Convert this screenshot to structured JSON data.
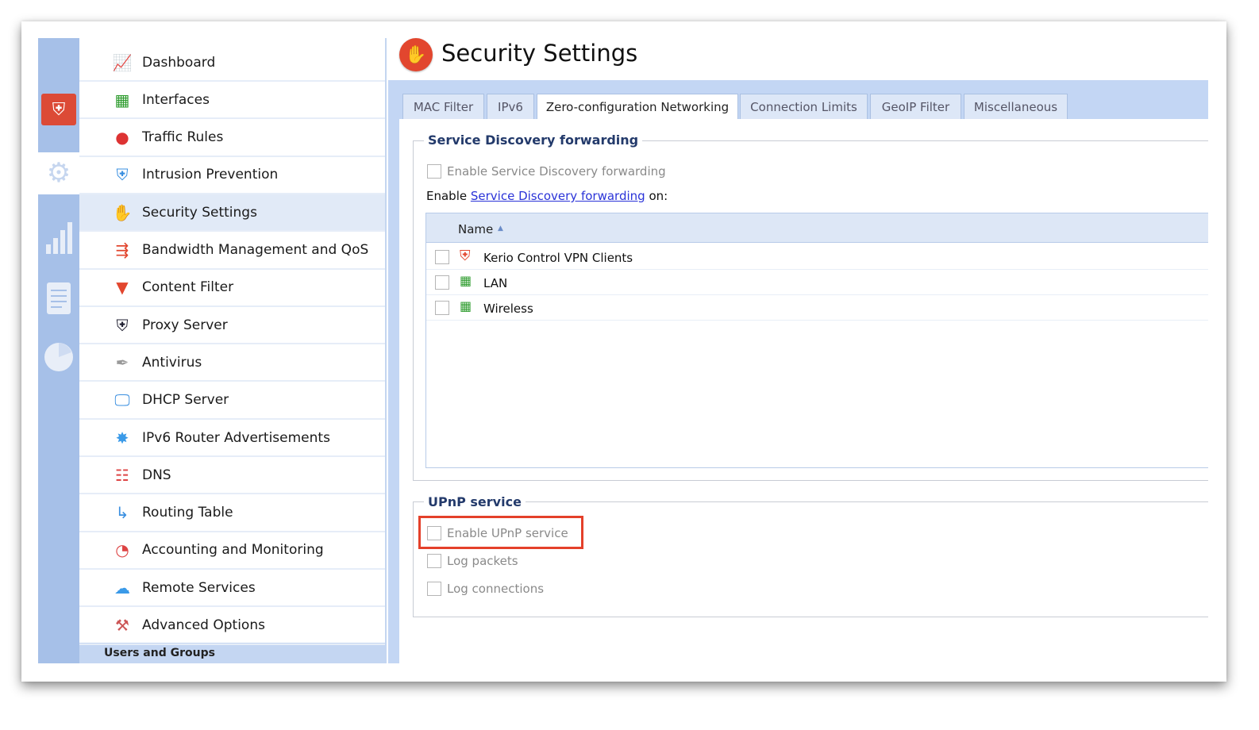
{
  "rail": {
    "items": [
      {
        "icon": "shield-icon"
      },
      {
        "icon": "gear-icon"
      },
      {
        "icon": "bar-chart-icon"
      },
      {
        "icon": "log-document-icon"
      },
      {
        "icon": "pie-chart-icon"
      }
    ]
  },
  "sidebar": {
    "items": [
      {
        "label": "Dashboard",
        "icon": "dashboard-icon"
      },
      {
        "label": "Interfaces",
        "icon": "network-card-icon"
      },
      {
        "label": "Traffic Rules",
        "icon": "traffic-light-icon"
      },
      {
        "label": "Intrusion Prevention",
        "icon": "shield-icon"
      },
      {
        "label": "Security Settings",
        "icon": "hand-stop-icon",
        "active": true
      },
      {
        "label": "Bandwidth Management and QoS",
        "icon": "bandwidth-arrow-icon"
      },
      {
        "label": "Content Filter",
        "icon": "funnel-icon"
      },
      {
        "label": "Proxy Server",
        "icon": "proxy-shield-icon"
      },
      {
        "label": "Antivirus",
        "icon": "syringe-icon"
      },
      {
        "label": "DHCP Server",
        "icon": "monitor-clock-icon"
      },
      {
        "label": "IPv6 Router Advertisements",
        "icon": "router-icon"
      },
      {
        "label": "DNS",
        "icon": "dns-tree-icon"
      },
      {
        "label": "Routing Table",
        "icon": "routing-arrows-icon"
      },
      {
        "label": "Accounting and Monitoring",
        "icon": "report-chart-icon"
      },
      {
        "label": "Remote Services",
        "icon": "cloud-gear-icon"
      },
      {
        "label": "Advanced Options",
        "icon": "tools-icon"
      }
    ],
    "footer": "Users and Groups"
  },
  "header": {
    "title": "Security Settings",
    "icon": "hand-stop-icon"
  },
  "tabs": [
    {
      "label": "MAC Filter"
    },
    {
      "label": "IPv6"
    },
    {
      "label": "Zero-configuration Networking",
      "active": true
    },
    {
      "label": "Connection Limits"
    },
    {
      "label": "GeoIP Filter"
    },
    {
      "label": "Miscellaneous"
    }
  ],
  "sdf": {
    "legend": "Service Discovery forwarding",
    "enable_label": "Enable Service Discovery forwarding",
    "enable_checked": false,
    "on_prefix": "Enable ",
    "on_link": "Service Discovery forwarding",
    "on_suffix": " on:",
    "grid": {
      "column": "Name",
      "sort": "ascending",
      "rows": [
        {
          "name": "Kerio Control VPN Clients",
          "icon": "vpn-shield-icon",
          "checked": false
        },
        {
          "name": "LAN",
          "icon": "network-card-icon",
          "checked": false
        },
        {
          "name": "Wireless",
          "icon": "network-card-icon",
          "checked": false
        }
      ]
    }
  },
  "upnp": {
    "legend": "UPnP service",
    "options": [
      {
        "label": "Enable UPnP service",
        "checked": false,
        "highlighted": true
      },
      {
        "label": "Log packets",
        "checked": false
      },
      {
        "label": "Log connections",
        "checked": false
      }
    ]
  },
  "colors": {
    "accent": "#dc4a36",
    "rail": "#a6c0e8",
    "highlight": "#e4402a",
    "link": "#2a33d8"
  }
}
